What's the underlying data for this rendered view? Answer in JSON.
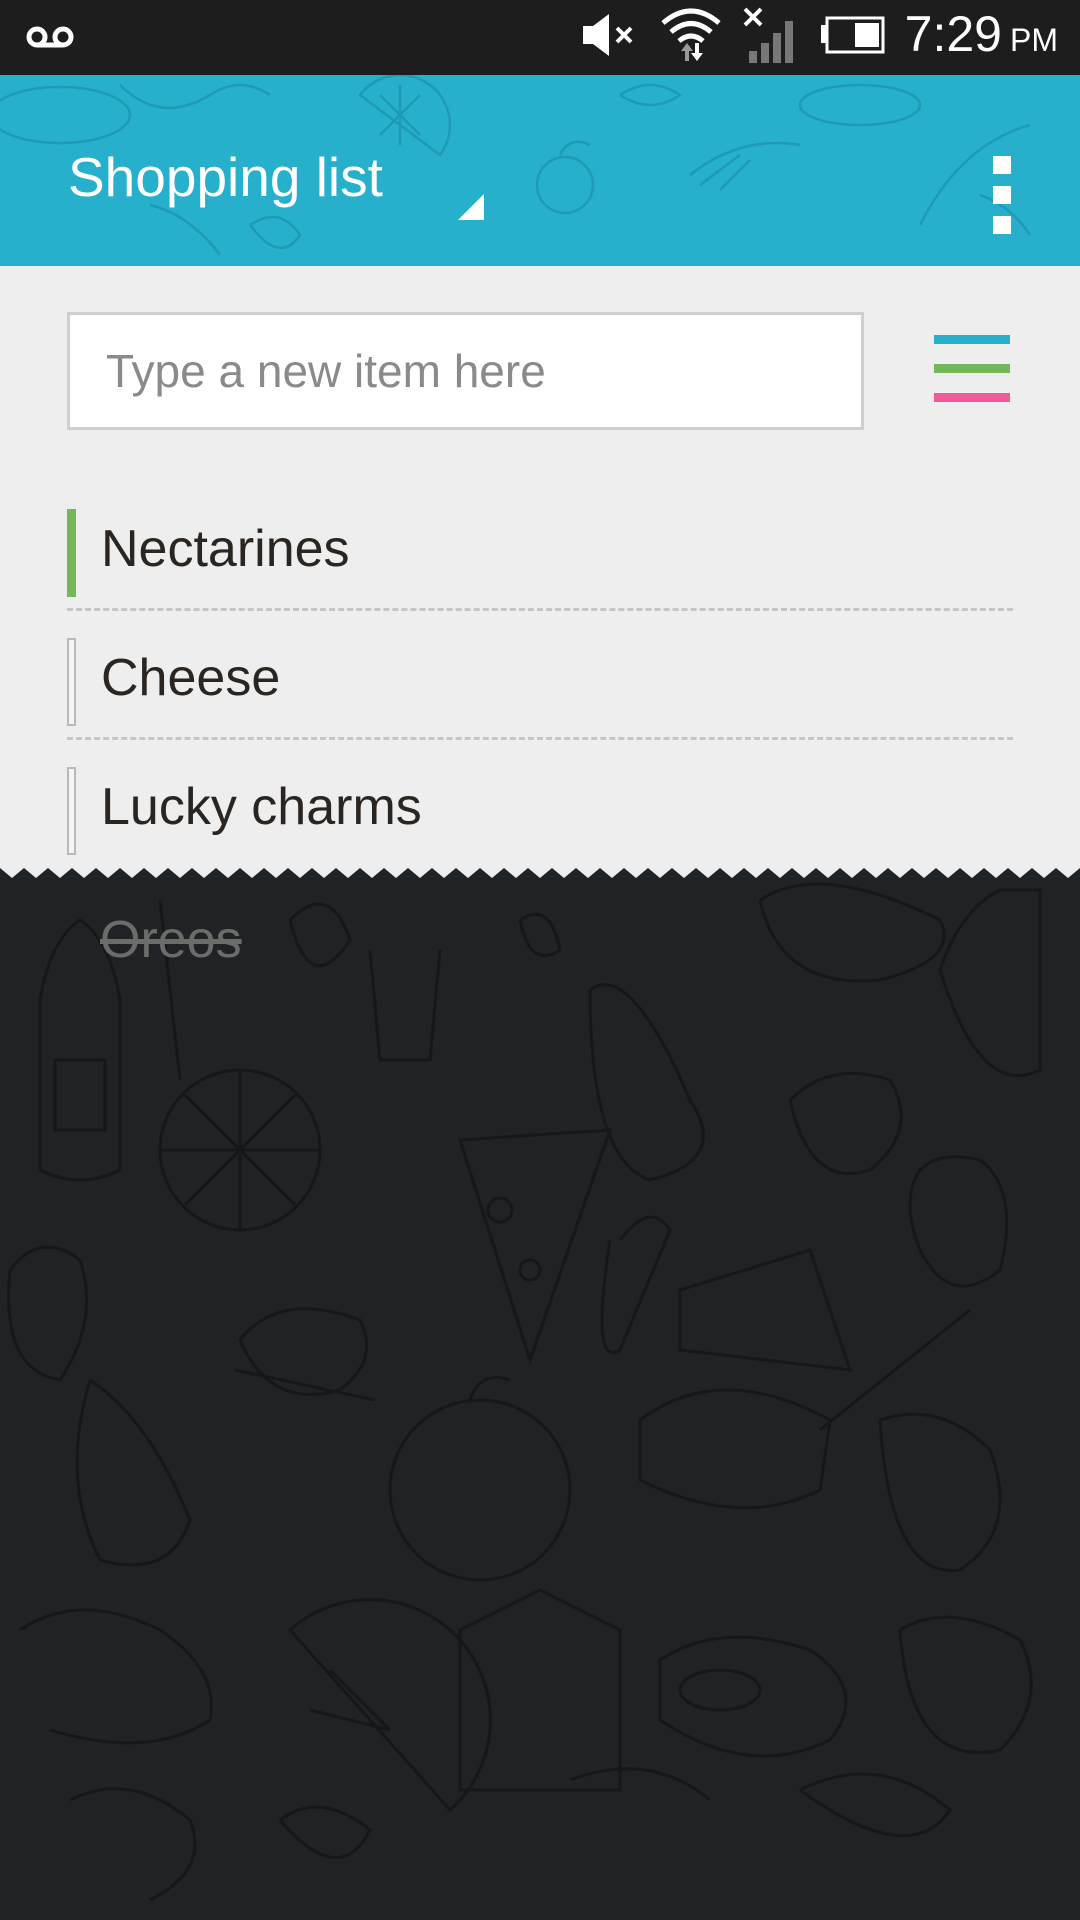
{
  "status_bar": {
    "time": "7:29",
    "ampm": "PM",
    "icons": [
      "voicemail-icon",
      "mute-icon",
      "wifi-icon",
      "no-signal-icon",
      "battery-icon"
    ]
  },
  "app_bar": {
    "title": "Shopping list",
    "background_color": "#27b0cc",
    "menu_icon": "overflow-menu-icon"
  },
  "new_item": {
    "placeholder": "Type a new item here",
    "value": ""
  },
  "sort_button": {
    "icon": "color-sort-icon",
    "colors": [
      "#27b0cc",
      "#75b85c",
      "#f05a9c"
    ]
  },
  "items": [
    {
      "label": "Nectarines",
      "priority": "high",
      "marker_color": "#75b85c"
    },
    {
      "label": "Cheese",
      "priority": "none"
    },
    {
      "label": "Lucky charms",
      "priority": "none"
    }
  ],
  "completed_items": [
    {
      "label": "Oreos"
    }
  ]
}
